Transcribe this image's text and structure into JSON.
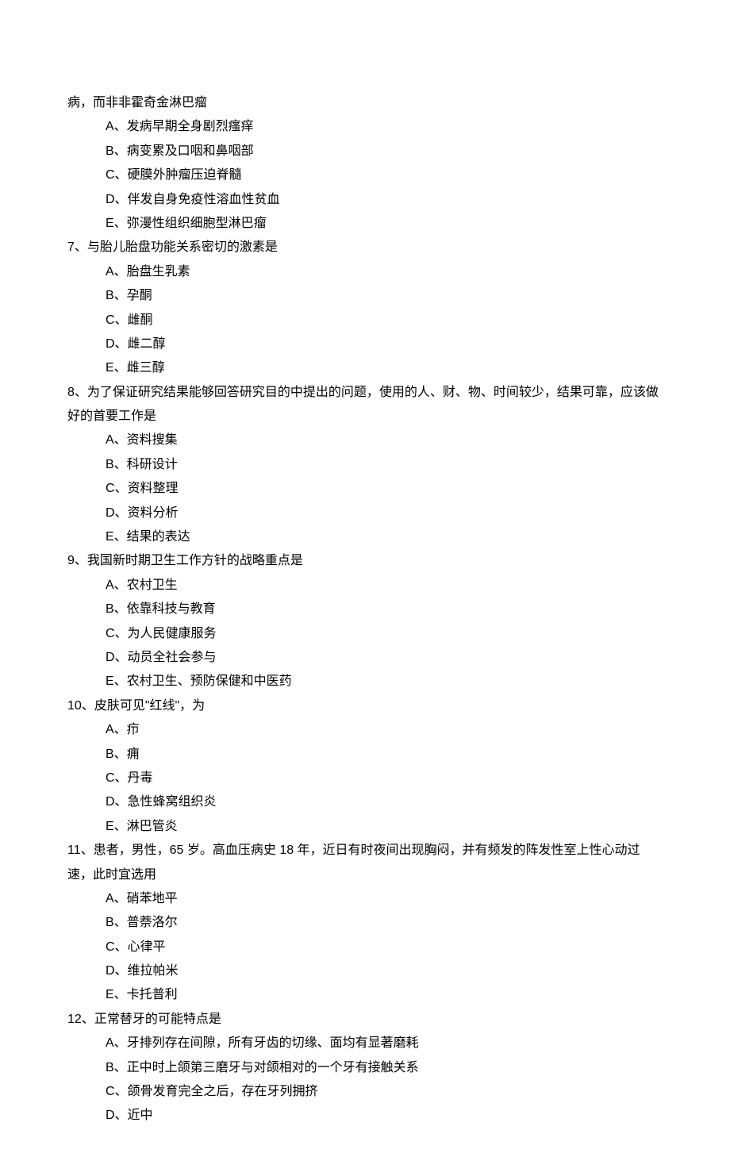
{
  "continued_stem": "病，而非非霍奇金淋巴瘤",
  "questions": [
    {
      "num": "",
      "stem": "",
      "options": [
        "A、发病早期全身剧烈瘙痒",
        "B、病变累及口咽和鼻咽部",
        "C、硬膜外肿瘤压迫脊髓",
        "D、伴发自身免疫性溶血性贫血",
        "E、弥漫性组织细胞型淋巴瘤"
      ]
    },
    {
      "num": "7、",
      "stem": "与胎儿胎盘功能关系密切的激素是",
      "options": [
        "A、胎盘生乳素",
        "B、孕酮",
        "C、雌酮",
        "D、雌二醇",
        "E、雌三醇"
      ]
    },
    {
      "num": "8、",
      "stem": "为了保证研究结果能够回答研究目的中提出的问题，使用的人、财、物、时间较少，结果可靠，应该做好的首要工作是",
      "options": [
        "A、资料搜集",
        "B、科研设计",
        "C、资料整理",
        "D、资料分析",
        "E、结果的表达"
      ]
    },
    {
      "num": "9、",
      "stem": "我国新时期卫生工作方针的战略重点是",
      "options": [
        "A、农村卫生",
        "B、依靠科技与教育",
        "C、为人民健康服务",
        "D、动员全社会参与",
        "E、农村卫生、预防保健和中医药"
      ]
    },
    {
      "num": "10、",
      "stem": "皮肤可见\"红线\"，为",
      "options": [
        "A、疖",
        "B、痈",
        "C、丹毒",
        "D、急性蜂窝组织炎",
        "E、淋巴管炎"
      ]
    },
    {
      "num": "11、",
      "stem": "患者，男性，65 岁。高血压病史 18 年，近日有时夜间出现胸闷，并有频发的阵发性室上性心动过速，此时宜选用",
      "options": [
        "A、硝苯地平",
        "B、普萘洛尔",
        "C、心律平",
        "D、维拉帕米",
        "E、卡托普利"
      ]
    },
    {
      "num": "12、",
      "stem": "正常替牙的可能特点是",
      "options": [
        "A、牙排列存在间隙，所有牙齿的切缘、面均有显著磨耗",
        "B、正中时上颌第三磨牙与对颌相对的一个牙有接触关系",
        "C、颌骨发育完全之后，存在牙列拥挤",
        "D、近中"
      ]
    }
  ]
}
